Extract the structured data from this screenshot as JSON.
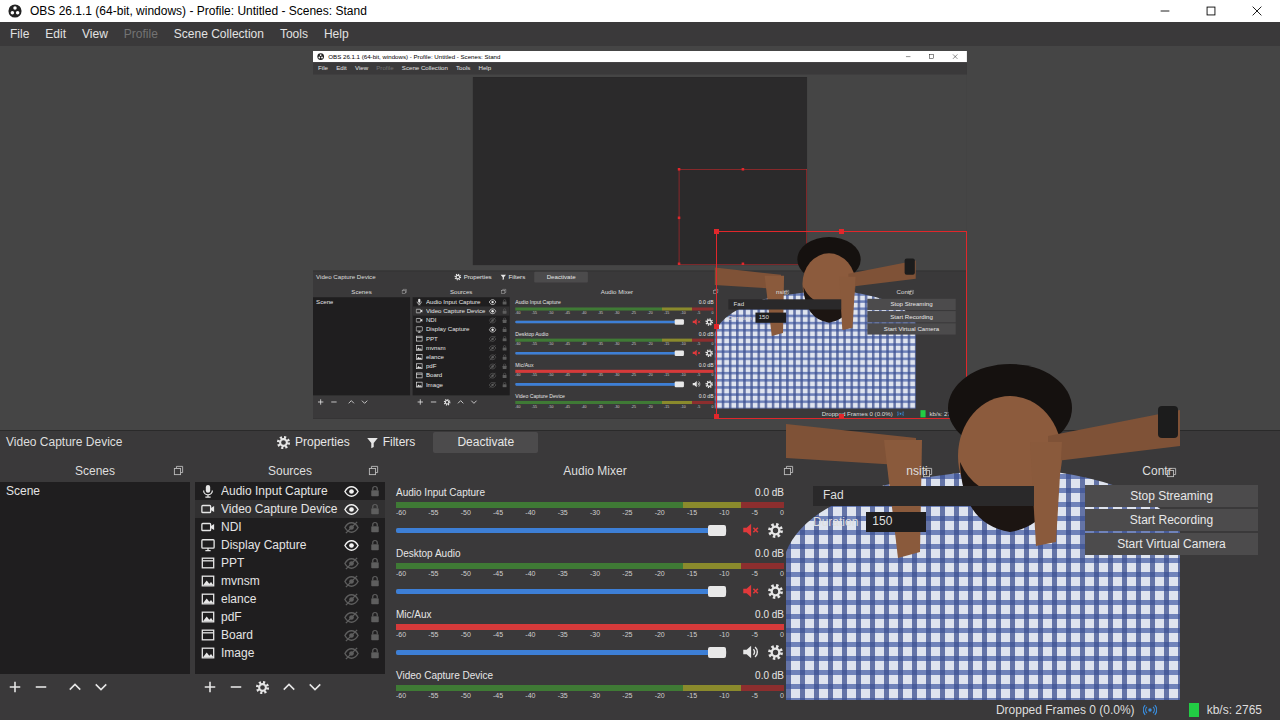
{
  "window": {
    "title": "OBS 26.1.1 (64-bit, windows) - Profile: Untitled - Scenes: Stand"
  },
  "menu": [
    {
      "label": "File",
      "disabled": false
    },
    {
      "label": "Edit",
      "disabled": false
    },
    {
      "label": "View",
      "disabled": false
    },
    {
      "label": "Profile",
      "disabled": true
    },
    {
      "label": "Scene Collection",
      "disabled": false
    },
    {
      "label": "Tools",
      "disabled": false
    },
    {
      "label": "Help",
      "disabled": false
    }
  ],
  "context_bar": {
    "source": "Video Capture Device",
    "buttons": [
      "Properties",
      "Filters",
      "Deactivate"
    ]
  },
  "scenes": {
    "title": "Scenes",
    "items": [
      {
        "label": "Scene",
        "selected": false
      }
    ]
  },
  "sources": {
    "title": "Sources",
    "items": [
      {
        "label": "Audio Input Capture",
        "kind": "audio",
        "visible": true,
        "selected": false
      },
      {
        "label": "Video Capture Device",
        "kind": "camera",
        "visible": true,
        "selected": true
      },
      {
        "label": "NDI",
        "kind": "camera",
        "visible": false,
        "selected": false
      },
      {
        "label": "Display Capture",
        "kind": "display",
        "visible": true,
        "selected": false
      },
      {
        "label": "PPT",
        "kind": "window",
        "visible": false,
        "selected": false
      },
      {
        "label": "mvnsm",
        "kind": "image",
        "visible": false,
        "selected": false
      },
      {
        "label": "elance",
        "kind": "image",
        "visible": false,
        "selected": false
      },
      {
        "label": "pdF",
        "kind": "image",
        "visible": false,
        "selected": false
      },
      {
        "label": "Board",
        "kind": "window",
        "visible": false,
        "selected": false
      },
      {
        "label": "Image",
        "kind": "image",
        "visible": false,
        "selected": false
      }
    ]
  },
  "audio_mixer": {
    "title": "Audio Mixer",
    "ticks": [
      "-60",
      "-55",
      "-50",
      "-45",
      "-40",
      "-35",
      "-30",
      "-25",
      "-20",
      "-15",
      "-10",
      "-5",
      "0"
    ],
    "channels": [
      {
        "name": "Audio Input Capture",
        "reading": "0.0 dB",
        "muted": true,
        "level": 0.97,
        "meter_color": "#3f7a35"
      },
      {
        "name": "Desktop Audio",
        "reading": "0.0 dB",
        "muted": true,
        "level": 0.97,
        "meter_color": "#3f7a35"
      },
      {
        "name": "Mic/Aux",
        "reading": "0.0 dB",
        "muted": false,
        "level": 0.97,
        "meter_color": "#d63a3a"
      },
      {
        "name": "Video Capture Device",
        "reading": "0.0 dB",
        "muted": false,
        "level": 0.97,
        "meter_color": "#3f7a35"
      }
    ]
  },
  "transitions": {
    "title": "nsiti",
    "transition": "Fad",
    "duration_label": "Duration",
    "duration": "150"
  },
  "controls": {
    "title": "Contr",
    "buttons": [
      "Stop Streaming",
      "Start Recording",
      "Start Virtual Camera"
    ]
  },
  "status_bar": {
    "dropped_frames": "Dropped Frames 0 (0.0%)",
    "streaming": true,
    "bitrate": "kb/s: 2765"
  }
}
